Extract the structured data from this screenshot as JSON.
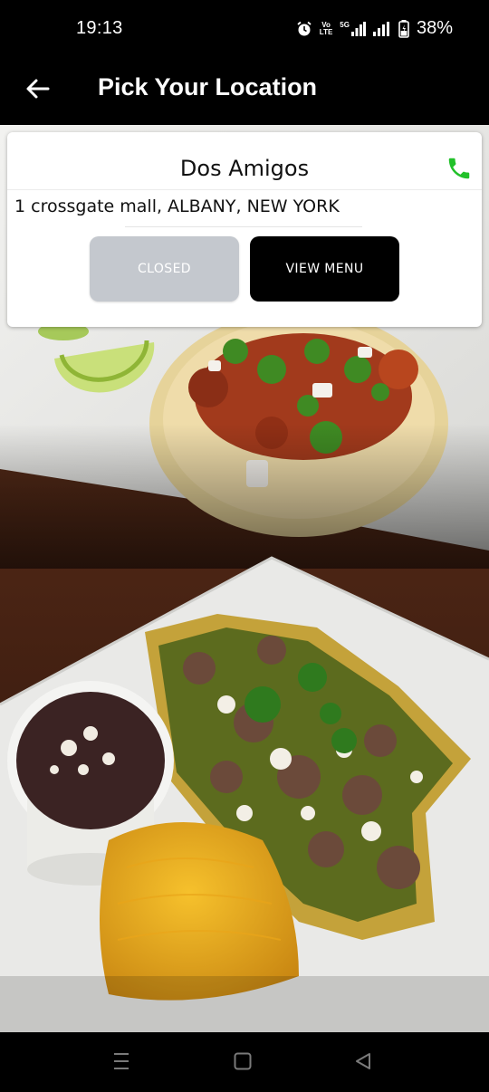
{
  "status_bar": {
    "time": "19:13",
    "volte_label": "VoLTE",
    "net_label": "5G",
    "battery_percent": "38%",
    "icons": [
      "alarm-icon",
      "volte-icon",
      "5g-signal-icon",
      "signal-icon",
      "battery-icon"
    ]
  },
  "header": {
    "back_icon": "back-arrow-icon",
    "title": "Pick Your Location"
  },
  "location_card": {
    "name": "Dos Amigos",
    "address": "1 crossgate mall, ALBANY, NEW YORK",
    "phone_icon": "phone-icon",
    "phone_color": "#22c12a",
    "closed_label": "CLOSED",
    "view_menu_label": "VIEW MENU"
  },
  "nav_bar": {
    "icons": [
      "menu-lines-icon",
      "home-square-icon",
      "back-triangle-icon"
    ]
  }
}
